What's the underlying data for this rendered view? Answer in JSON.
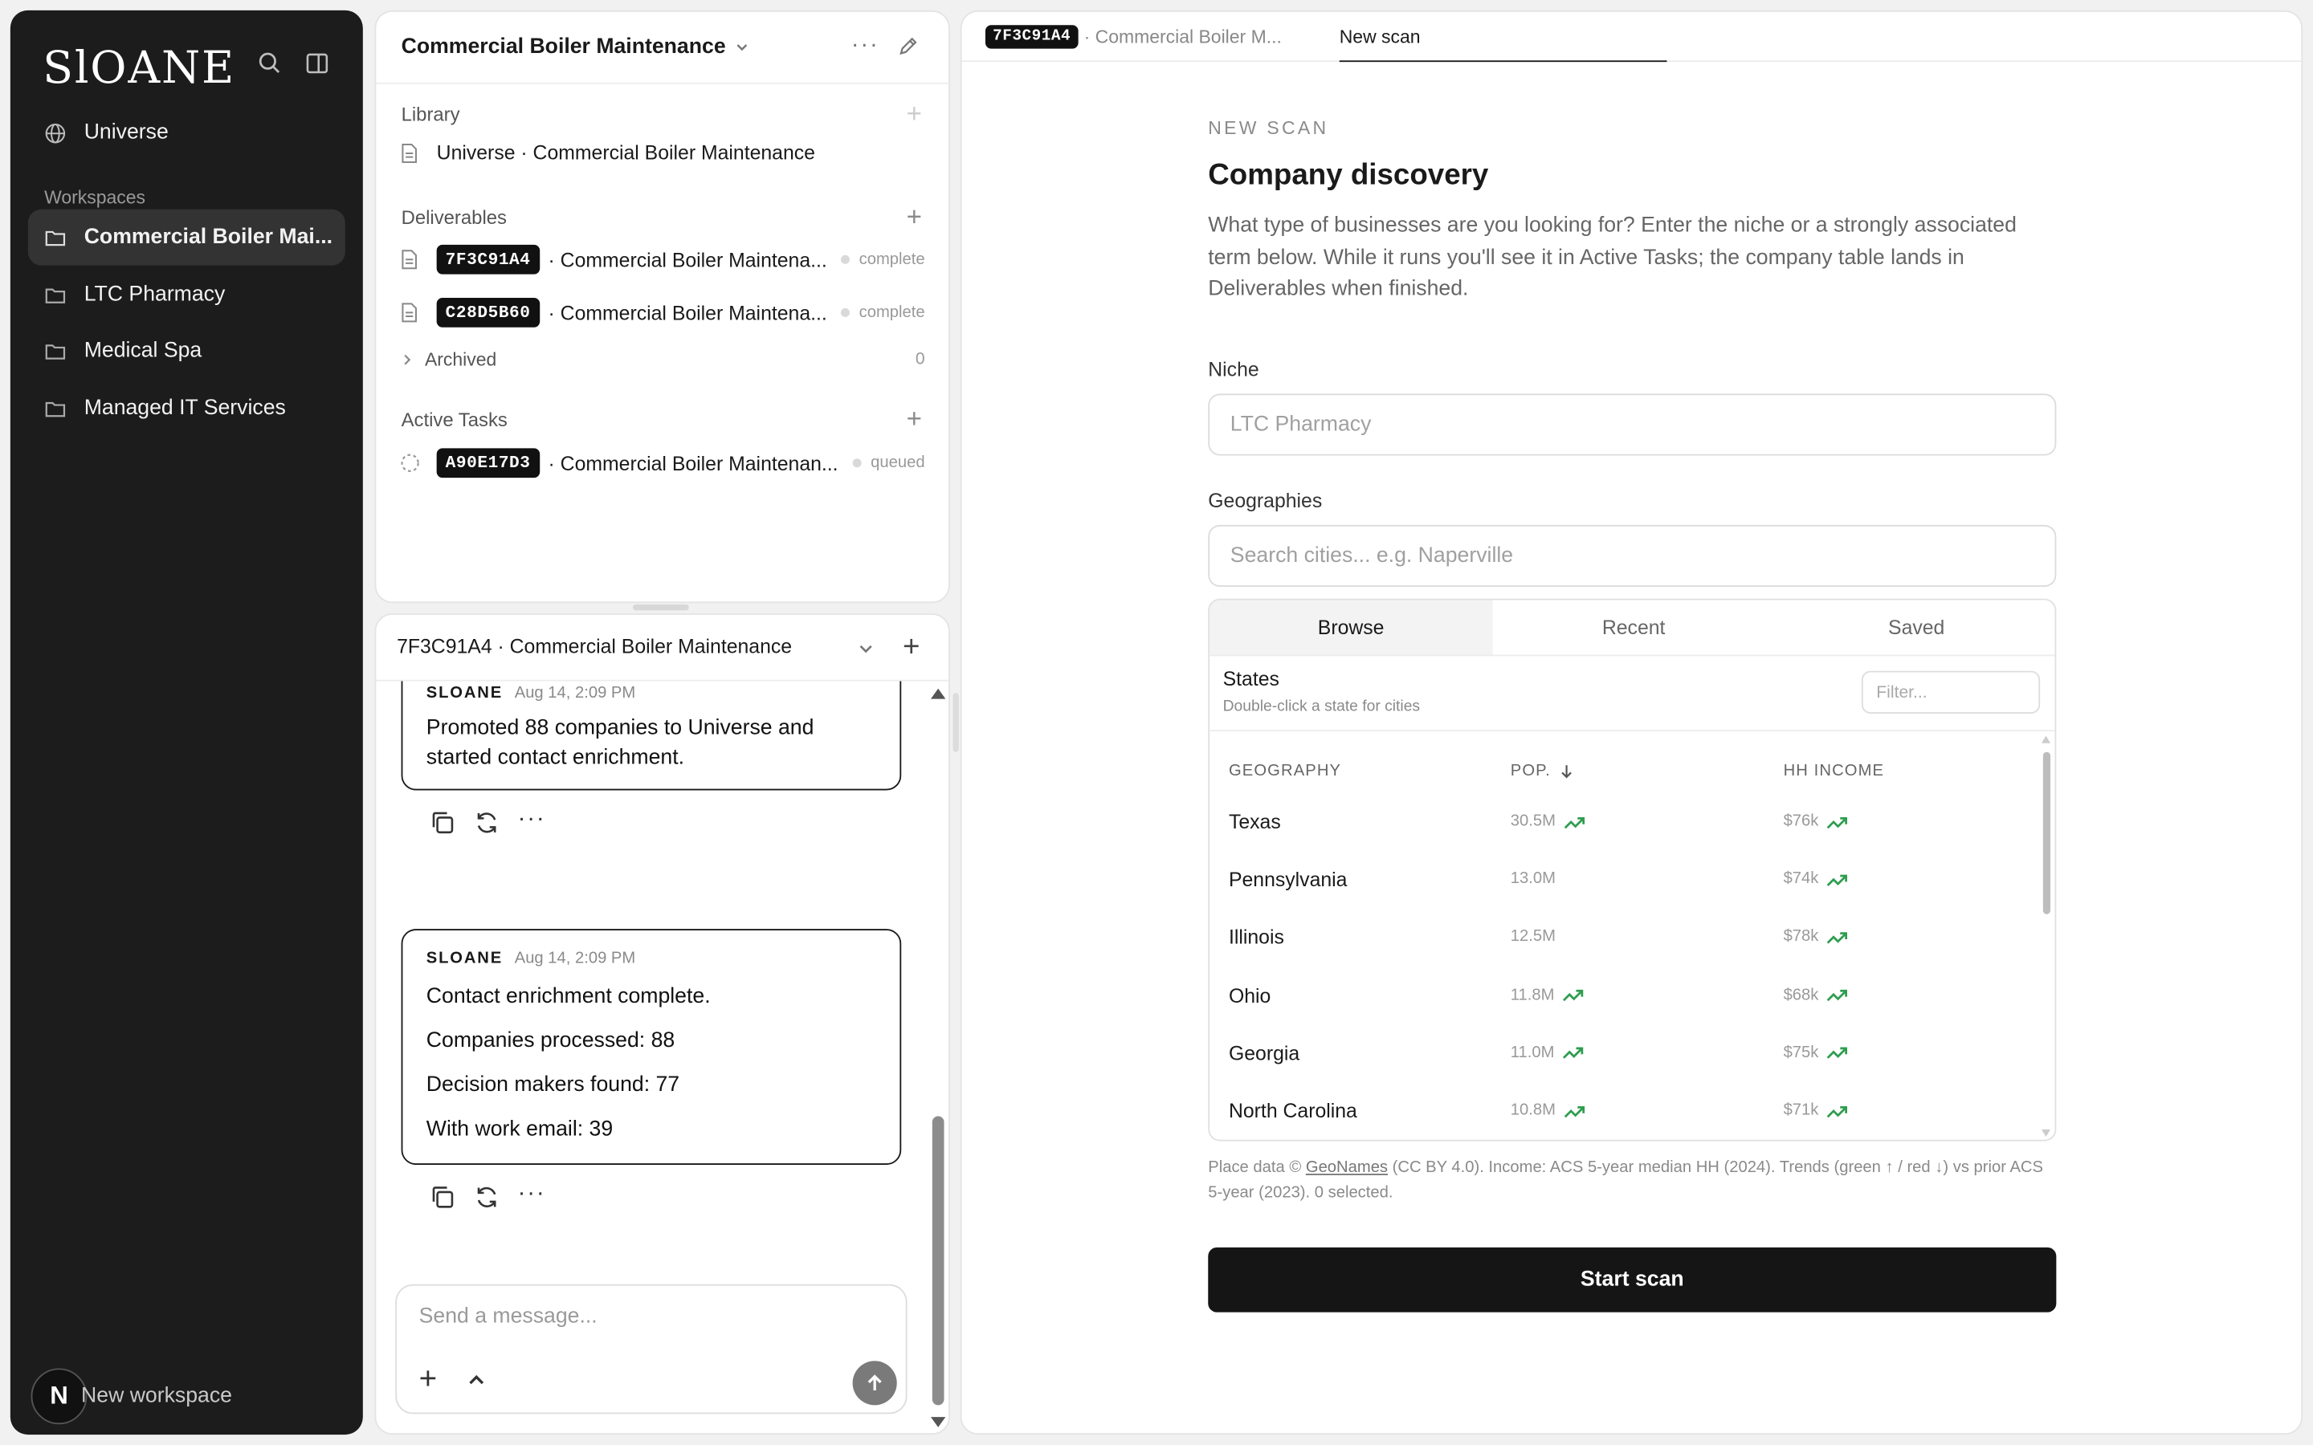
{
  "sidebar": {
    "logo": "SlOANE",
    "universe": "Universe",
    "section_label": "Workspaces",
    "workspaces": [
      {
        "label": "Commercial Boiler Mai..."
      },
      {
        "label": "LTC Pharmacy"
      },
      {
        "label": "Medical Spa"
      },
      {
        "label": "Managed IT Services"
      }
    ],
    "new_workspace": "New workspace",
    "avatar_initial": "N"
  },
  "workspace_panel": {
    "title": "Commercial Boiler Maintenance",
    "library_label": "Library",
    "library_item": "Universe · Commercial Boiler Maintenance",
    "deliverables_label": "Deliverables",
    "deliverables": [
      {
        "code": "7F3C91A4",
        "title": "· Commercial Boiler Maintena...",
        "status": "complete"
      },
      {
        "code": "C28D5B60",
        "title": "· Commercial Boiler Maintena...",
        "status": "complete"
      }
    ],
    "archived_label": "Archived",
    "archived_count": "0",
    "active_tasks_label": "Active Tasks",
    "active_tasks": [
      {
        "code": "A90E17D3",
        "title": "· Commercial Boiler Maintenan...",
        "status": "queued"
      }
    ]
  },
  "chat": {
    "header": "7F3C91A4 · Commercial Boiler Maintenance",
    "messages": [
      {
        "sender": "SLOANE",
        "time": "Aug 14, 2:09 PM",
        "lines": [
          "Promoted 88 companies to Universe and started contact enrichment."
        ]
      },
      {
        "sender": "SLOANE",
        "time": "Aug 14, 2:09 PM",
        "lines": [
          "Contact enrichment complete.",
          "Companies processed: 88",
          "Decision makers found: 77",
          "With work email: 39"
        ]
      }
    ],
    "composer_placeholder": "Send a message..."
  },
  "main": {
    "tabs": [
      {
        "code": "7F3C91A4",
        "label": "· Commercial Boiler M..."
      },
      {
        "label": "New scan"
      }
    ],
    "eyebrow": "NEW SCAN",
    "heading": "Company discovery",
    "description": "What type of businesses are you looking for? Enter the niche or a strongly associated term below. While it runs you'll see it in Active Tasks; the company table lands in Deliverables when finished.",
    "niche_label": "Niche",
    "niche_placeholder": "LTC Pharmacy",
    "geo_label": "Geographies",
    "geo_placeholder": "Search cities... e.g. Naperville",
    "browse_tabs": [
      "Browse",
      "Recent",
      "Saved"
    ],
    "states_title": "States",
    "states_hint": "Double-click a state for cities",
    "filter_placeholder": "Filter...",
    "columns": [
      "GEOGRAPHY",
      "POP.",
      "HH INCOME"
    ],
    "rows": [
      {
        "geo": "Texas",
        "pop": "30.5M",
        "pop_trend": "up",
        "income": "$76k",
        "income_trend": "up"
      },
      {
        "geo": "Pennsylvania",
        "pop": "13.0M",
        "pop_trend": "",
        "income": "$74k",
        "income_trend": "up"
      },
      {
        "geo": "Illinois",
        "pop": "12.5M",
        "pop_trend": "",
        "income": "$78k",
        "income_trend": "up"
      },
      {
        "geo": "Ohio",
        "pop": "11.8M",
        "pop_trend": "up",
        "income": "$68k",
        "income_trend": "up"
      },
      {
        "geo": "Georgia",
        "pop": "11.0M",
        "pop_trend": "up",
        "income": "$75k",
        "income_trend": "up"
      },
      {
        "geo": "North Carolina",
        "pop": "10.8M",
        "pop_trend": "up",
        "income": "$71k",
        "income_trend": "up"
      }
    ],
    "footnote_pre": "Place data © ",
    "footnote_link": "GeoNames",
    "footnote_post": " (CC BY 4.0). Income: ACS 5-year median HH (2024). Trends (green ↑ / red ↓) vs prior ACS 5-year (2023). 0 selected.",
    "start_button": "Start scan"
  },
  "colors": {
    "trend_up": "#2e9d4f",
    "dark": "#151515",
    "sidebar_bg": "#1c1c1c"
  }
}
